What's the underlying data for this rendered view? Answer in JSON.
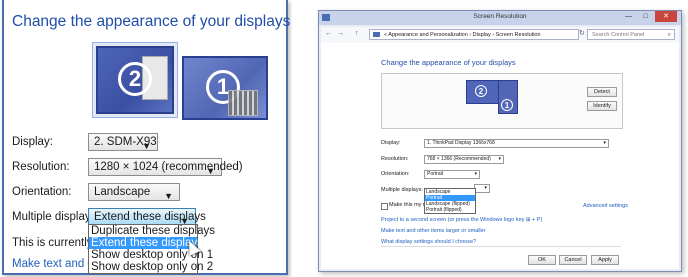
{
  "left": {
    "title": "Change the appearance of your displays",
    "monitor_numbers": [
      "2",
      "1"
    ],
    "display_label": "Display:",
    "display_value": "2. SDM-X93",
    "resolution_label": "Resolution:",
    "resolution_value": "1280 × 1024 (recommended)",
    "orientation_label": "Orientation:",
    "orientation_value": "Landscape",
    "multiple_label": "Multiple displays:",
    "multiple_value": "Extend these displays",
    "multiple_options": [
      "Duplicate these displays",
      "Extend these displays",
      "Show desktop only on 1",
      "Show desktop only on 2"
    ],
    "multiple_selected_index": 1,
    "info_text": "This is currently you",
    "link_text": "Make text and other"
  },
  "right": {
    "window_title": "Screen Resolution",
    "controls": {
      "min": "—",
      "max": "□",
      "close": "✕"
    },
    "nav": {
      "back": "←",
      "forward": "→",
      "up": "↑"
    },
    "breadcrumb": "« Appearance and Personalization › Display › Screen Resolution",
    "search_placeholder": "Search Control Panel",
    "heading": "Change the appearance of your displays",
    "monitor_numbers": [
      "2",
      "1"
    ],
    "detect_label": "Detect",
    "identify_label": "Identify",
    "display_label": "Display:",
    "display_value": "1. ThinkPad Display 1366x768",
    "resolution_label": "Resolution:",
    "resolution_value": "768 × 1366 (Recommended)",
    "orientation_label": "Orientation:",
    "orientation_value": "Portrait",
    "orientation_options": [
      "Landscape",
      "Portrait",
      "Landscape (flipped)",
      "Portrait (flipped)"
    ],
    "orientation_selected_index": 1,
    "multiple_label": "Multiple displays:",
    "main_display_text": "Make this my m",
    "advanced_link": "Advanced settings",
    "project_link": "Project to a second screen (or press the Windows logo key ⊞ + P)",
    "text_size_link": "Make text and other items larger or smaller",
    "which_settings_link": "What display settings should I choose?",
    "ok_label": "OK",
    "cancel_label": "Cancel",
    "apply_label": "Apply"
  },
  "colors": {
    "accent": "#1f4fa8",
    "link": "#1f5fbf",
    "monitor": "#4f66b8",
    "highlight": "#3399ff",
    "close": "#c9463d"
  }
}
